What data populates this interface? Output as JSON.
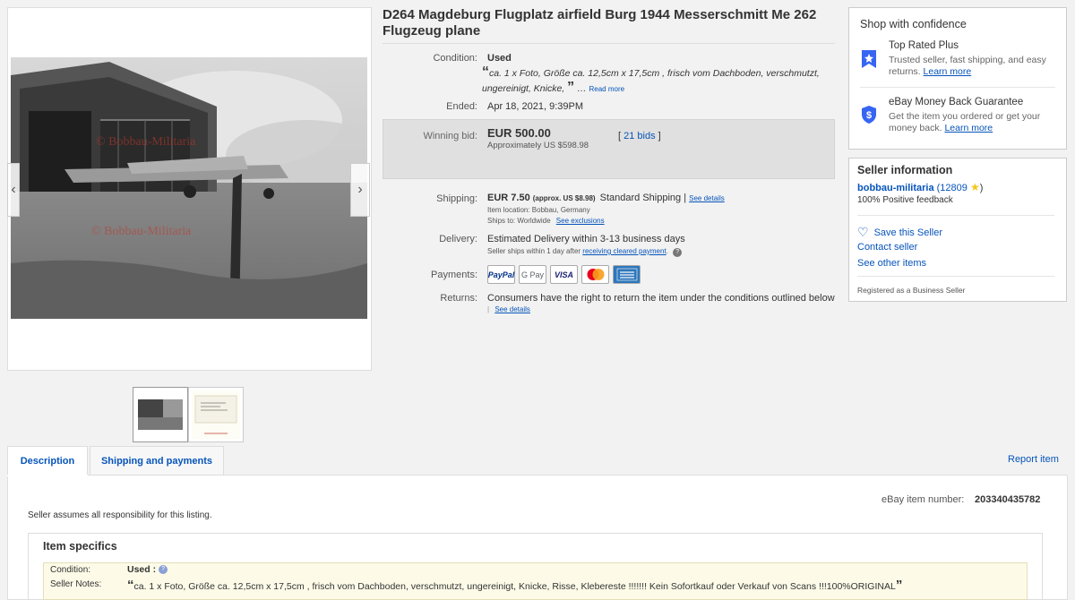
{
  "gallery": {
    "watermark": "© Bobbau-Militaria",
    "prev_icon": "‹",
    "next_icon": "›"
  },
  "listing": {
    "title": "D264 Magdeburg Flugplatz airfield Burg 1944 Messerschmitt Me 262 Flugzeug plane",
    "condition_label": "Condition:",
    "condition_value": "Used",
    "condition_notes": "ca. 1 x Foto, Größe ca. 12,5cm x 17,5cm , frisch vom Dachboden, verschmutzt, ungereinigt, Knicke,",
    "read_more": "Read more",
    "ended_label": "Ended:",
    "ended_value": "Apr 18, 2021, 9:39PM",
    "winning_label": "Winning bid:",
    "winning_value": "EUR 500.00",
    "approx": "Approximately US $598.98",
    "bids": "21 bids",
    "shipping_label": "Shipping:",
    "shipping_cost": "EUR 7.50",
    "shipping_approx": "(approx. US $8.98)",
    "shipping_method": "Standard Shipping",
    "see_details": "See details",
    "item_location": "Item location:  Bobbau, Germany",
    "ships_to": "Ships to:  Worldwide",
    "see_exclusions": "See exclusions",
    "delivery_label": "Delivery:",
    "delivery_value": "Estimated Delivery within 3-13 business days",
    "delivery_note": "Seller ships within 1 day after",
    "receiving_cleared": "receiving cleared payment",
    "payments_label": "Payments:",
    "returns_label": "Returns:",
    "returns_value": "Consumers have the right to return the item under the conditions outlined below",
    "returns_details": "See details"
  },
  "payments": [
    "PayPal",
    "G Pay",
    "VISA",
    "Mastercard",
    "AMEX"
  ],
  "confidence": {
    "title": "Shop with confidence",
    "trp_title": "Top Rated Plus",
    "trp_text": "Trusted seller, fast shipping, and easy returns.",
    "learn_more": "Learn more",
    "mbg_title": "eBay Money Back Guarantee",
    "mbg_text": "Get the item you ordered or get your money back.",
    "learn_more2": "Learn more"
  },
  "seller": {
    "title": "Seller information",
    "name": "bobbau-militaria",
    "score": "(12809",
    "score_end": ")",
    "feedback": "100% Positive feedback",
    "save": "Save this Seller",
    "contact": "Contact seller",
    "other": "See other items",
    "registered": "Registered as a Business Seller"
  },
  "tabs": {
    "description": "Description",
    "shipping": "Shipping and payments",
    "report": "Report item"
  },
  "description": {
    "item_number_label": "eBay item number:",
    "item_number": "203340435782",
    "responsibility": "Seller assumes all responsibility for this listing.",
    "specifics_title": "Item specifics",
    "spec_condition_label": "Condition:",
    "spec_condition_value": "Used :",
    "spec_notes_label": "Seller Notes:",
    "spec_notes_value": "ca. 1 x Foto, Größe ca. 12,5cm x 17,5cm , frisch vom Dachboden, verschmutzt, ungereinigt, Knicke, Risse, Klebereste !!!!!!! Kein Sofortkauf oder Verkauf von Scans !!!100%ORIGINAL"
  },
  "colors": {
    "link": "#0654ba",
    "badge": "#3665f3",
    "star": "#f5c518"
  }
}
